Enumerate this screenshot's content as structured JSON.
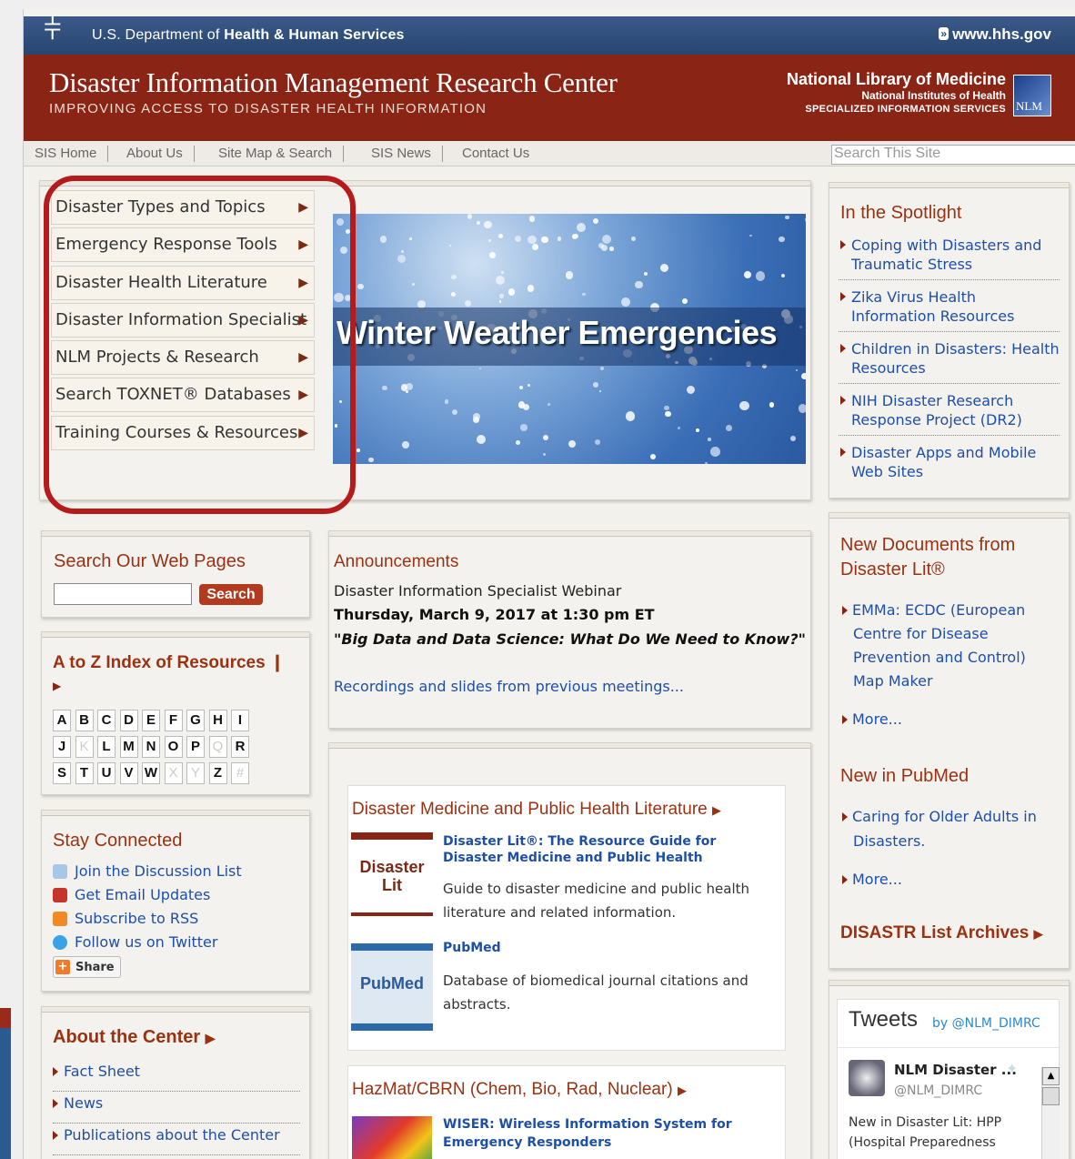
{
  "top_bar": {
    "agency_prefix": "U.S. Department of",
    "agency_name": "Health & Human Services",
    "site_link": "www.hhs.gov"
  },
  "banner": {
    "title": "Disaster Information Management Research Center",
    "subtitle": "IMPROVING ACCESS TO DISASTER HEALTH INFORMATION",
    "nlm_line1": "National Library of Medicine",
    "nlm_line2": "National Institutes of Health",
    "nlm_line3": "SPECIALIZED INFORMATION SERVICES",
    "nlm_logo": "NLM"
  },
  "nav": {
    "items": [
      "SIS Home",
      "About Us",
      "Site Map & Search",
      "SIS News",
      "Contact Us"
    ],
    "search_placeholder": "Search This Site"
  },
  "menu": {
    "items": [
      "Disaster Types and Topics",
      "Emergency Response Tools",
      "Disaster Health Literature",
      "Disaster Information Specialist",
      "NLM Projects & Research",
      "Search TOXNET® Databases",
      "Training Courses & Resources"
    ]
  },
  "hero": {
    "text": "Winter Weather Emergencies"
  },
  "spotlight": {
    "title": "In the Spotlight",
    "items": [
      "Coping with Disasters and Traumatic Stress",
      "Zika Virus Health Information Resources",
      "Children in Disasters: Health Resources",
      "NIH Disaster Research Response Project (DR2)",
      "Disaster Apps and Mobile Web Sites"
    ]
  },
  "search_panel": {
    "title": "Search Our Web Pages",
    "button": "Search",
    "value": ""
  },
  "az": {
    "title": "A to Z Index of Resources",
    "rows": [
      [
        "A",
        "B",
        "C",
        "D",
        "E",
        "F",
        "G",
        "H",
        "I"
      ],
      [
        "J",
        "K",
        "L",
        "M",
        "N",
        "O",
        "P",
        "Q",
        "R"
      ],
      [
        "S",
        "T",
        "U",
        "V",
        "W",
        "X",
        "Y",
        "Z",
        "#"
      ]
    ],
    "disabled": [
      "K",
      "Q",
      "X",
      "Y",
      "#"
    ]
  },
  "stay": {
    "title": "Stay Connected",
    "items": [
      "Join the Discussion List",
      "Get Email Updates",
      "Subscribe to RSS",
      "Follow us on Twitter"
    ],
    "share": "Share"
  },
  "about": {
    "title": "About the Center",
    "items": [
      "Fact Sheet",
      "News",
      "Publications about the Center"
    ]
  },
  "announcements": {
    "title": "Announcements",
    "line1": "Disaster Information Specialist Webinar",
    "line2": "Thursday, March 9, 2017 at 1:30 pm ET",
    "line3": "\"Big Data and Data Science: What Do We Need to Know?\"",
    "link": "Recordings and slides from previous meetings..."
  },
  "literature": {
    "title": "Disaster Medicine and Public Health Literature",
    "item1_logo": "Disaster Lit",
    "item1_title": "Disaster Lit®: The Resource Guide for Disaster Medicine and Public Health",
    "item1_desc": "Guide to disaster medicine and public health literature and related information.",
    "item2_logo": "PubMed",
    "item2_title": "PubMed",
    "item2_desc": "Database of biomedical journal citations and abstracts."
  },
  "hazmat": {
    "title": "HazMat/CBRN (Chem, Bio, Rad, Nuclear)",
    "item1_title": "WISER: Wireless Information System for Emergency Responders"
  },
  "new_docs": {
    "title": "New Documents from Disaster Lit®",
    "item": "EMMa: ECDC (European Centre for Disease Prevention and Control) Map Maker",
    "more": "More...",
    "pubmed_title": "New in PubMed",
    "pubmed_item": "Caring for Older Adults in Disasters.",
    "pubmed_more": "More...",
    "archives": "DISASTR List Archives"
  },
  "tweets": {
    "title": "Tweets",
    "by": "by @NLM_DIMRC",
    "user": "NLM Disaster ...",
    "handle": "@NLM_DIMRC",
    "text": "New in Disaster Lit: HPP (Hospital Preparedness"
  }
}
